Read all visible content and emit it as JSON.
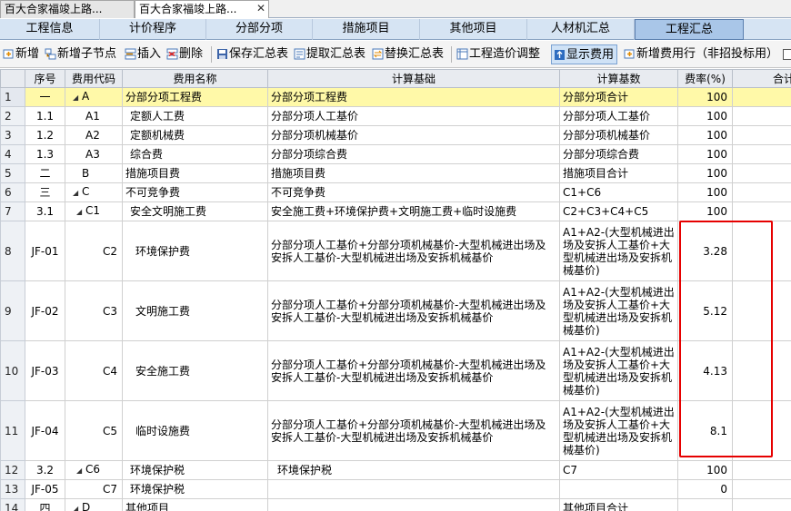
{
  "doc_tabs": [
    "百大合家福竣上路...",
    "百大合家福竣上路..."
  ],
  "module_tabs": [
    "工程信息",
    "计价程序",
    "分部分项",
    "措施项目",
    "其他项目",
    "人材机汇总",
    "工程汇总"
  ],
  "toolbar": {
    "add": "新增",
    "add_child": "新增子节点",
    "insert": "插入",
    "delete": "删除",
    "save_summary": "保存汇总表",
    "extract_summary": "提取汇总表",
    "replace_summary": "替换汇总表",
    "cost_adjust": "工程造价调整",
    "show_fee": "显示费用",
    "add_fee_row": "新增费用行（非招投标用）"
  },
  "columns": [
    "序号",
    "费用代码",
    "费用名称",
    "计算基础",
    "计算基数",
    "费率(%)",
    "合计"
  ],
  "rows": [
    {
      "rn": "1",
      "seq": "一",
      "code": "A",
      "name": "分部分项工程费",
      "basis": "分部分项工程费",
      "base": "分部分项合计",
      "rate": "100",
      "total": ""
    },
    {
      "rn": "2",
      "seq": "1.1",
      "code": "A1",
      "name": "定额人工费",
      "basis": "分部分项人工基价",
      "base": "分部分项人工基价",
      "rate": "100",
      "total": ""
    },
    {
      "rn": "3",
      "seq": "1.2",
      "code": "A2",
      "name": "定额机械费",
      "basis": "分部分项机械基价",
      "base": "分部分项机械基价",
      "rate": "100",
      "total": ""
    },
    {
      "rn": "4",
      "seq": "1.3",
      "code": "A3",
      "name": "综合费",
      "basis": "分部分项综合费",
      "base": "分部分项综合费",
      "rate": "100",
      "total": ""
    },
    {
      "rn": "5",
      "seq": "二",
      "code": "B",
      "name": "措施项目费",
      "basis": "措施项目费",
      "base": "措施项目合计",
      "rate": "100",
      "total": ""
    },
    {
      "rn": "6",
      "seq": "三",
      "code": "C",
      "name": "不可竞争费",
      "basis": "不可竞争费",
      "base": "C1+C6",
      "rate": "100",
      "total": ""
    },
    {
      "rn": "7",
      "seq": "3.1",
      "code": "C1",
      "name": "安全文明施工费",
      "basis": "安全施工费+环境保护费+文明施工费+临时设施费",
      "base": "C2+C3+C4+C5",
      "rate": "100",
      "total": ""
    },
    {
      "rn": "8",
      "seq": "JF-01",
      "code": "C2",
      "name": "环境保护费",
      "basis": "分部分项人工基价+分部分项机械基价-大型机械进出场及安拆人工基价-大型机械进出场及安拆机械基价",
      "base": "A1+A2-(大型机械进出场及安拆人工基价+大型机械进出场及安拆机械基价)",
      "rate": "3.28",
      "total": ""
    },
    {
      "rn": "9",
      "seq": "JF-02",
      "code": "C3",
      "name": "文明施工费",
      "basis": "分部分项人工基价+分部分项机械基价-大型机械进出场及安拆人工基价-大型机械进出场及安拆机械基价",
      "base": "A1+A2-(大型机械进出场及安拆人工基价+大型机械进出场及安拆机械基价)",
      "rate": "5.12",
      "total": ""
    },
    {
      "rn": "10",
      "seq": "JF-03",
      "code": "C4",
      "name": "安全施工费",
      "basis": "分部分项人工基价+分部分项机械基价-大型机械进出场及安拆人工基价-大型机械进出场及安拆机械基价",
      "base": "A1+A2-(大型机械进出场及安拆人工基价+大型机械进出场及安拆机械基价)",
      "rate": "4.13",
      "total": ""
    },
    {
      "rn": "11",
      "seq": "JF-04",
      "code": "C5",
      "name": "临时设施费",
      "basis": "分部分项人工基价+分部分项机械基价-大型机械进出场及安拆人工基价-大型机械进出场及安拆机械基价",
      "base": "A1+A2-(大型机械进出场及安拆人工基价+大型机械进出场及安拆机械基价)",
      "rate": "8.1",
      "total": ""
    },
    {
      "rn": "12",
      "seq": "3.2",
      "code": "C6",
      "name": "环境保护税",
      "basis": "环境保护税",
      "base": "C7",
      "rate": "100",
      "total": ""
    },
    {
      "rn": "13",
      "seq": "JF-05",
      "code": "C7",
      "name": "环境保护税",
      "basis": "",
      "base": "",
      "rate": "0",
      "total": ""
    },
    {
      "rn": "14",
      "seq": "四",
      "code": "D",
      "name": "其他项目",
      "basis": "",
      "base": "其他项目合计",
      "rate": "",
      "total": ""
    }
  ],
  "accent": {
    "highlight_row": "#fff9a8",
    "active_tab": "#a9c6e8",
    "annotation": "#e60000"
  }
}
